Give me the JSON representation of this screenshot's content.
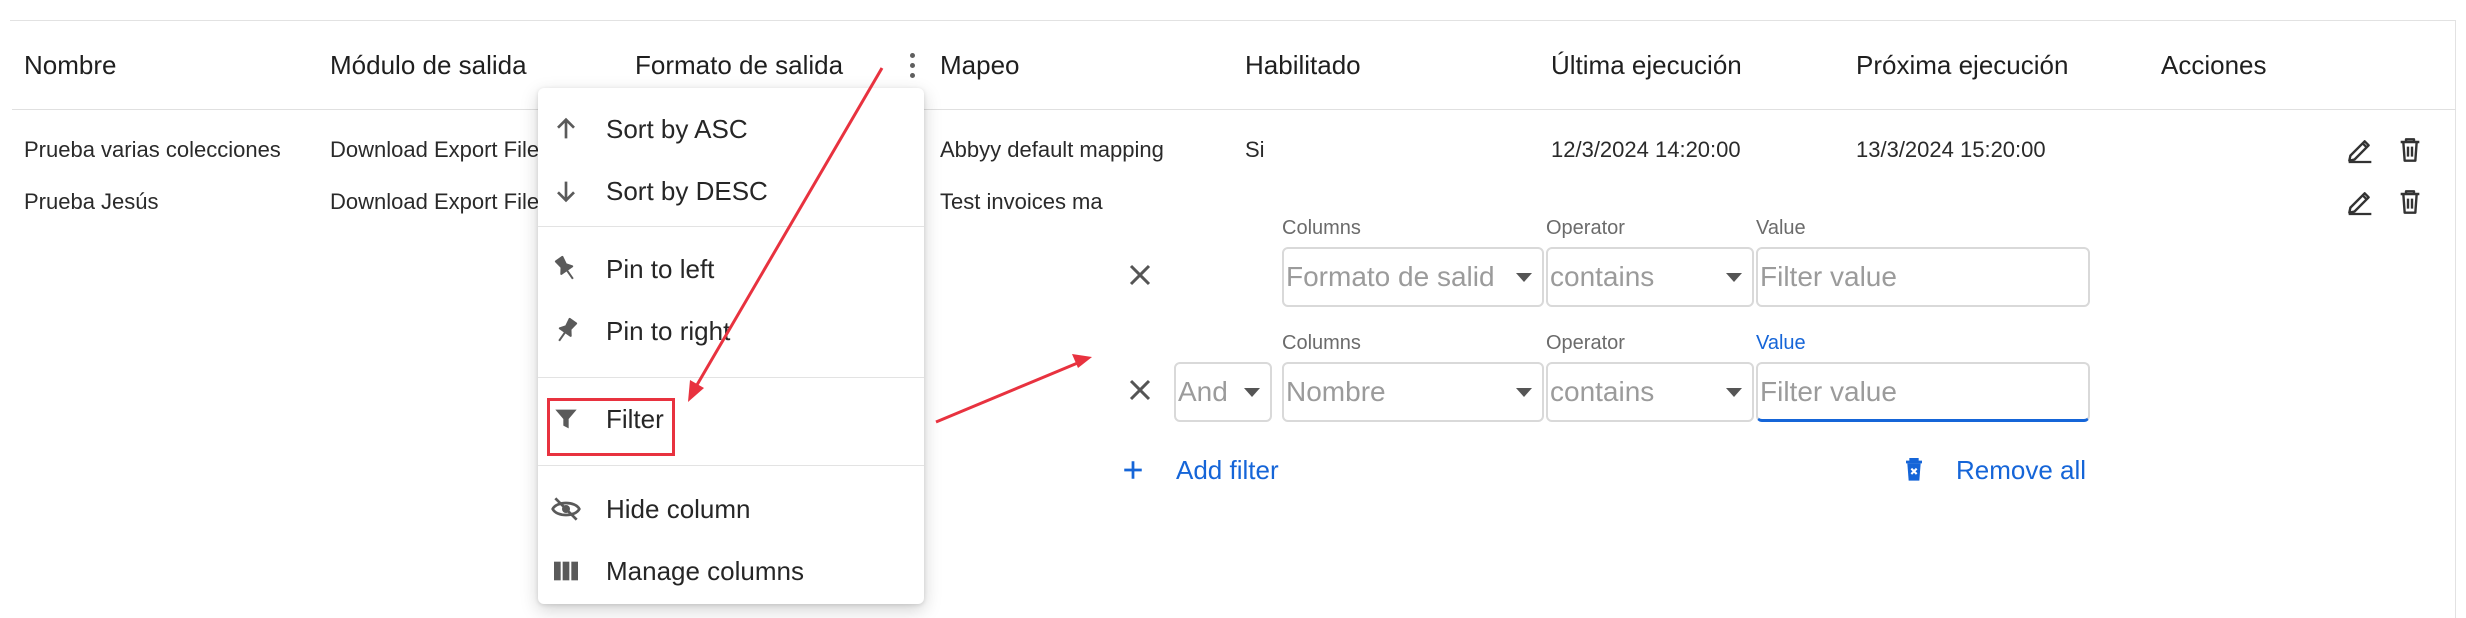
{
  "columns": [
    "Nombre",
    "Módulo de salida",
    "Formato de salida",
    "Mapeo",
    "Habilitado",
    "Última ejecución",
    "Próxima ejecución",
    "Acciones"
  ],
  "rows": [
    {
      "nombre": "Prueba varias colecciones",
      "modulo": "Download Export File",
      "formato": "",
      "mapeo": "Abbyy default mapping",
      "habilitado": "Si",
      "ultima": "12/3/2024 14:20:00",
      "proxima": "13/3/2024 15:20:00"
    },
    {
      "nombre": "Prueba Jesús",
      "modulo": "Download Export File",
      "formato": "",
      "mapeo": "Test invoices ma",
      "habilitado": "",
      "ultima": "",
      "proxima": ""
    }
  ],
  "column_menu": {
    "items": [
      "Sort by ASC",
      "Sort by DESC",
      "Pin to left",
      "Pin to right",
      "Filter",
      "Hide column",
      "Manage columns"
    ],
    "icons": [
      "arrow-up-icon",
      "arrow-down-icon",
      "pin-left-icon",
      "pin-right-icon",
      "filter-icon",
      "eye-off-icon",
      "columns-icon"
    ]
  },
  "filter_panel": {
    "labels": {
      "columns": "Columns",
      "operator": "Operator",
      "value": "Value"
    },
    "filters": [
      {
        "logic": "",
        "column": "Formato de salid",
        "operator": "contains",
        "value_placeholder": "Filter value"
      },
      {
        "logic": "And",
        "column": "Nombre",
        "operator": "contains",
        "value_placeholder": "Filter value"
      }
    ],
    "add_filter": "Add filter",
    "remove_all": "Remove all"
  },
  "colors": {
    "accent": "#1565d8",
    "annotation": "#e8323f",
    "border": "#e0e0e0"
  }
}
